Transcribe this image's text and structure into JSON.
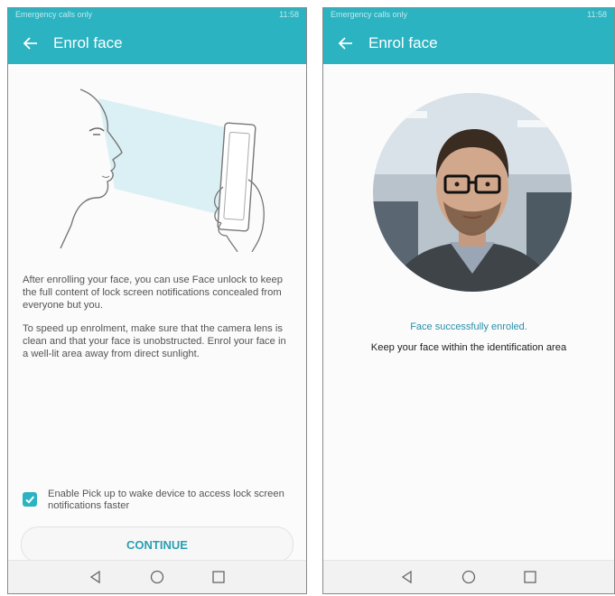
{
  "left_screen": {
    "status_text": "Emergency calls only",
    "status_right": "11:58",
    "title": "Enrol face",
    "paragraph1": "After enrolling your face, you can use Face unlock to keep the full content of lock screen notifications concealed from everyone but you.",
    "paragraph2": "To speed up enrolment, make sure that the camera lens is clean and that your face is unobstructed. Enrol your face in a well-lit area away from direct sunlight.",
    "checkbox_label": "Enable Pick up to wake device to access lock screen notifications faster",
    "checkbox_checked": true,
    "continue_label": "CONTINUE"
  },
  "right_screen": {
    "status_text": "Emergency calls only",
    "status_right": "11:58",
    "title": "Enrol face",
    "success_text": "Face successfully enroled.",
    "instruction_text": "Keep your face within the identification area"
  },
  "colors": {
    "accent": "#2bb3c2",
    "continue_text": "#2a9fb0",
    "success_text": "#2a8fa8"
  },
  "icons": {
    "back": "arrow-left-icon",
    "nav_back": "triangle-back-icon",
    "nav_home": "circle-home-icon",
    "nav_recents": "square-recents-icon",
    "checkbox": "checkmark-icon"
  }
}
